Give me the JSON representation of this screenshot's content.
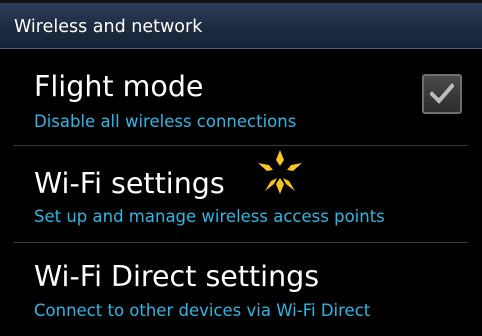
{
  "header": {
    "title": "Wireless and network"
  },
  "items": [
    {
      "title": "Flight mode",
      "summary": "Disable all wireless connections",
      "checked": true
    },
    {
      "title": "Wi-Fi settings",
      "summary": "Set up and manage wireless access points"
    },
    {
      "title": "Wi-Fi Direct settings",
      "summary": "Connect to other devices via Wi-Fi Direct"
    }
  ],
  "icons": {
    "checkbox_check": "check-icon",
    "tap_indicator": "tap-indicator-icon"
  },
  "colors": {
    "summary_text": "#2fb7e4",
    "header_bg": "#1d2b40",
    "tap_indicator": "#f7c51e"
  }
}
